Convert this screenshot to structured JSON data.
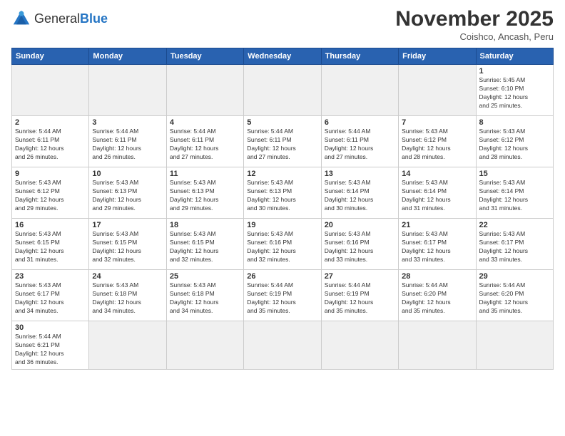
{
  "header": {
    "logo_text_normal": "General",
    "logo_text_bold": "Blue",
    "month_title": "November 2025",
    "subtitle": "Coishco, Ancash, Peru"
  },
  "days_of_week": [
    "Sunday",
    "Monday",
    "Tuesday",
    "Wednesday",
    "Thursday",
    "Friday",
    "Saturday"
  ],
  "weeks": [
    [
      {
        "day": "",
        "info": ""
      },
      {
        "day": "",
        "info": ""
      },
      {
        "day": "",
        "info": ""
      },
      {
        "day": "",
        "info": ""
      },
      {
        "day": "",
        "info": ""
      },
      {
        "day": "",
        "info": ""
      },
      {
        "day": "1",
        "info": "Sunrise: 5:45 AM\nSunset: 6:10 PM\nDaylight: 12 hours\nand 25 minutes."
      }
    ],
    [
      {
        "day": "2",
        "info": "Sunrise: 5:44 AM\nSunset: 6:11 PM\nDaylight: 12 hours\nand 26 minutes."
      },
      {
        "day": "3",
        "info": "Sunrise: 5:44 AM\nSunset: 6:11 PM\nDaylight: 12 hours\nand 26 minutes."
      },
      {
        "day": "4",
        "info": "Sunrise: 5:44 AM\nSunset: 6:11 PM\nDaylight: 12 hours\nand 27 minutes."
      },
      {
        "day": "5",
        "info": "Sunrise: 5:44 AM\nSunset: 6:11 PM\nDaylight: 12 hours\nand 27 minutes."
      },
      {
        "day": "6",
        "info": "Sunrise: 5:44 AM\nSunset: 6:11 PM\nDaylight: 12 hours\nand 27 minutes."
      },
      {
        "day": "7",
        "info": "Sunrise: 5:43 AM\nSunset: 6:12 PM\nDaylight: 12 hours\nand 28 minutes."
      },
      {
        "day": "8",
        "info": "Sunrise: 5:43 AM\nSunset: 6:12 PM\nDaylight: 12 hours\nand 28 minutes."
      }
    ],
    [
      {
        "day": "9",
        "info": "Sunrise: 5:43 AM\nSunset: 6:12 PM\nDaylight: 12 hours\nand 29 minutes."
      },
      {
        "day": "10",
        "info": "Sunrise: 5:43 AM\nSunset: 6:13 PM\nDaylight: 12 hours\nand 29 minutes."
      },
      {
        "day": "11",
        "info": "Sunrise: 5:43 AM\nSunset: 6:13 PM\nDaylight: 12 hours\nand 29 minutes."
      },
      {
        "day": "12",
        "info": "Sunrise: 5:43 AM\nSunset: 6:13 PM\nDaylight: 12 hours\nand 30 minutes."
      },
      {
        "day": "13",
        "info": "Sunrise: 5:43 AM\nSunset: 6:14 PM\nDaylight: 12 hours\nand 30 minutes."
      },
      {
        "day": "14",
        "info": "Sunrise: 5:43 AM\nSunset: 6:14 PM\nDaylight: 12 hours\nand 31 minutes."
      },
      {
        "day": "15",
        "info": "Sunrise: 5:43 AM\nSunset: 6:14 PM\nDaylight: 12 hours\nand 31 minutes."
      }
    ],
    [
      {
        "day": "16",
        "info": "Sunrise: 5:43 AM\nSunset: 6:15 PM\nDaylight: 12 hours\nand 31 minutes."
      },
      {
        "day": "17",
        "info": "Sunrise: 5:43 AM\nSunset: 6:15 PM\nDaylight: 12 hours\nand 32 minutes."
      },
      {
        "day": "18",
        "info": "Sunrise: 5:43 AM\nSunset: 6:15 PM\nDaylight: 12 hours\nand 32 minutes."
      },
      {
        "day": "19",
        "info": "Sunrise: 5:43 AM\nSunset: 6:16 PM\nDaylight: 12 hours\nand 32 minutes."
      },
      {
        "day": "20",
        "info": "Sunrise: 5:43 AM\nSunset: 6:16 PM\nDaylight: 12 hours\nand 33 minutes."
      },
      {
        "day": "21",
        "info": "Sunrise: 5:43 AM\nSunset: 6:17 PM\nDaylight: 12 hours\nand 33 minutes."
      },
      {
        "day": "22",
        "info": "Sunrise: 5:43 AM\nSunset: 6:17 PM\nDaylight: 12 hours\nand 33 minutes."
      }
    ],
    [
      {
        "day": "23",
        "info": "Sunrise: 5:43 AM\nSunset: 6:17 PM\nDaylight: 12 hours\nand 34 minutes."
      },
      {
        "day": "24",
        "info": "Sunrise: 5:43 AM\nSunset: 6:18 PM\nDaylight: 12 hours\nand 34 minutes."
      },
      {
        "day": "25",
        "info": "Sunrise: 5:43 AM\nSunset: 6:18 PM\nDaylight: 12 hours\nand 34 minutes."
      },
      {
        "day": "26",
        "info": "Sunrise: 5:44 AM\nSunset: 6:19 PM\nDaylight: 12 hours\nand 35 minutes."
      },
      {
        "day": "27",
        "info": "Sunrise: 5:44 AM\nSunset: 6:19 PM\nDaylight: 12 hours\nand 35 minutes."
      },
      {
        "day": "28",
        "info": "Sunrise: 5:44 AM\nSunset: 6:20 PM\nDaylight: 12 hours\nand 35 minutes."
      },
      {
        "day": "29",
        "info": "Sunrise: 5:44 AM\nSunset: 6:20 PM\nDaylight: 12 hours\nand 35 minutes."
      }
    ],
    [
      {
        "day": "30",
        "info": "Sunrise: 5:44 AM\nSunset: 6:21 PM\nDaylight: 12 hours\nand 36 minutes."
      },
      {
        "day": "",
        "info": ""
      },
      {
        "day": "",
        "info": ""
      },
      {
        "day": "",
        "info": ""
      },
      {
        "day": "",
        "info": ""
      },
      {
        "day": "",
        "info": ""
      },
      {
        "day": "",
        "info": ""
      }
    ]
  ]
}
